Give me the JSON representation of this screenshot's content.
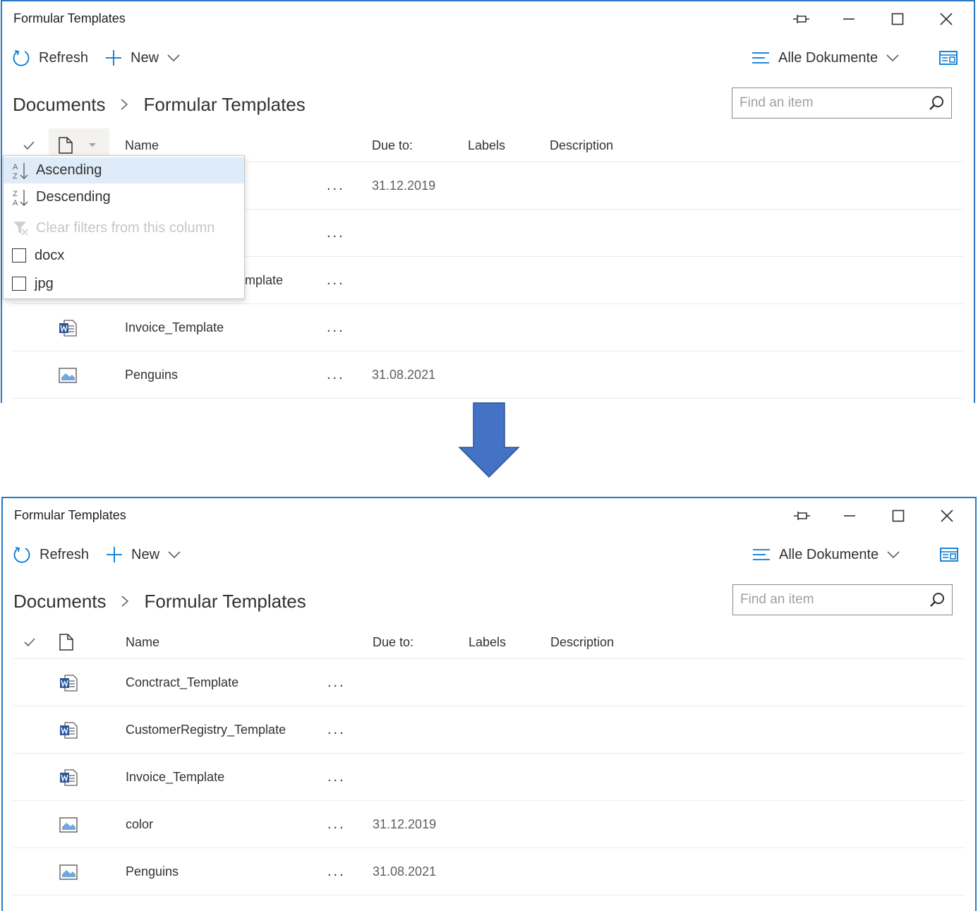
{
  "window_title": "Formular Templates",
  "toolbar": {
    "refresh_label": "Refresh",
    "new_label": "New",
    "view_label": "Alle Dokumente"
  },
  "breadcrumb": {
    "root": "Documents",
    "current": "Formular Templates"
  },
  "search": {
    "placeholder": "Find an item"
  },
  "columns": {
    "name": "Name",
    "due": "Due to:",
    "labels": "Labels",
    "description": "Description"
  },
  "more_label": "...",
  "before": {
    "sort_menu": {
      "ascending": "Ascending",
      "descending": "Descending",
      "clear_filters": "Clear filters from this column",
      "filter_docx": "docx",
      "filter_jpg": "jpg"
    },
    "rows": [
      {
        "name": "",
        "due": "31.12.2019",
        "icon": "image-file-icon"
      },
      {
        "name": "",
        "due": "",
        "icon": "word-file-icon"
      },
      {
        "name": "mplate",
        "due": "",
        "icon": "word-file-icon"
      },
      {
        "name": "Invoice_Template",
        "due": "",
        "icon": "word-file-icon"
      },
      {
        "name": "Penguins",
        "due": "31.08.2021",
        "icon": "image-file-icon"
      }
    ]
  },
  "after": {
    "rows": [
      {
        "name": "Conctract_Template",
        "due": "",
        "icon": "word-file-icon"
      },
      {
        "name": "CustomerRegistry_Template",
        "due": "",
        "icon": "word-file-icon"
      },
      {
        "name": "Invoice_Template",
        "due": "",
        "icon": "word-file-icon"
      },
      {
        "name": "color",
        "due": "31.12.2019",
        "icon": "image-file-icon"
      },
      {
        "name": "Penguins",
        "due": "31.08.2021",
        "icon": "image-file-icon"
      }
    ]
  },
  "colors": {
    "window_border": "#2b78c5",
    "accent": "#0078d4",
    "arrow": "#4472c4",
    "selected_item": "#deecf9",
    "word_blue": "#2b579a"
  }
}
